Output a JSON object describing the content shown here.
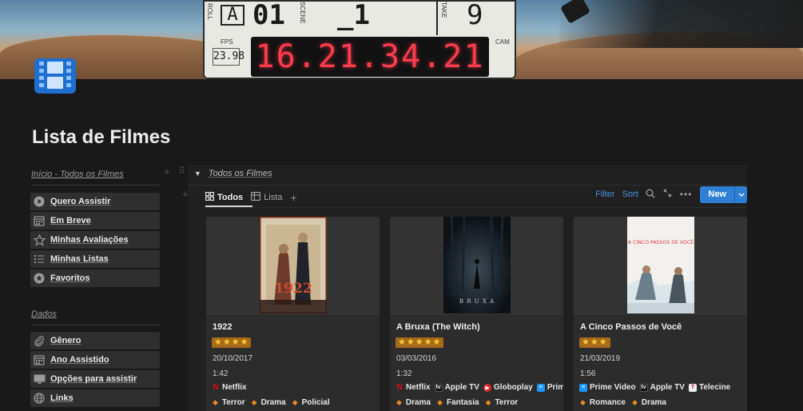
{
  "cover": {
    "slate": {
      "roll_label": "ROLL",
      "roll_value": "A",
      "scene_label": "SCENE",
      "scene_value": "01",
      "shot_value": "_1",
      "take_label": "TAKE",
      "take_value": "9",
      "fps_label": "FPS",
      "fps_value": "23.98",
      "cam_label": "CAM",
      "timecode": "16.21.34.21"
    }
  },
  "page": {
    "icon": "film-icon",
    "title": "Lista de Filmes"
  },
  "nav": {
    "section1_title": "Início - Todos os Filmes",
    "section1_items": [
      {
        "label": "Quero Assistir",
        "icon": "play-circle-icon"
      },
      {
        "label": "Em Breve",
        "icon": "calendar-icon"
      },
      {
        "label": "Minhas Avaliações",
        "icon": "star-outline-icon"
      },
      {
        "label": "Minhas Listas",
        "icon": "list-icon"
      },
      {
        "label": "Favoritos",
        "icon": "star-circle-icon"
      }
    ],
    "section2_title": "Dados",
    "section2_items": [
      {
        "label": "Gênero",
        "icon": "paperclip-icon"
      },
      {
        "label": "Ano Assistido",
        "icon": "calendar-icon"
      },
      {
        "label": "Opções para assistir",
        "icon": "monitor-icon"
      },
      {
        "label": "Links",
        "icon": "globe-icon"
      }
    ]
  },
  "database": {
    "title": "Todos os Filmes",
    "views": [
      {
        "label": "Todos",
        "icon": "gallery-icon",
        "active": true
      },
      {
        "label": "Lista",
        "icon": "table-icon",
        "active": false
      }
    ],
    "toolbar": {
      "filter_label": "Filter",
      "sort_label": "Sort",
      "new_label": "New"
    },
    "cards": [
      {
        "name": "1922",
        "stars": "★★★★",
        "rating": 4,
        "date": "20/10/2017",
        "duration": "1:42",
        "streams": [
          {
            "label": "Netflix",
            "icon": "netflix-icon"
          }
        ],
        "genres": [
          "Terror",
          "Drama",
          "Policial"
        ]
      },
      {
        "name": "A Bruxa (The Witch)",
        "stars": "★★★★★",
        "rating": 5,
        "date": "03/03/2016",
        "duration": "1:32",
        "streams": [
          {
            "label": "Netflix",
            "icon": "netflix-icon"
          },
          {
            "label": "Apple TV",
            "icon": "appletv-icon"
          },
          {
            "label": "Globoplay",
            "icon": "globoplay-icon"
          },
          {
            "label": "Prime V",
            "icon": "primevideo-icon"
          }
        ],
        "genres": [
          "Drama",
          "Fantasia",
          "Terror"
        ]
      },
      {
        "name": "A Cinco Passos de Você",
        "stars": "★★★",
        "rating": 3,
        "date": "21/03/2019",
        "duration": "1:56",
        "streams": [
          {
            "label": "Prime Video",
            "icon": "primevideo-icon"
          },
          {
            "label": "Apple TV",
            "icon": "appletv-icon"
          },
          {
            "label": "Telecine",
            "icon": "telecine-icon"
          }
        ],
        "genres": [
          "Romance",
          "Drama"
        ]
      }
    ]
  },
  "posters": {
    "p1_title": "1922",
    "p2_title": "B R U X A",
    "p3_title": "A CINCO PASSOS DE VOCÊ"
  },
  "colors": {
    "background": "#191919",
    "accent_blue": "#2f80d5",
    "link_blue": "#4a90d9",
    "star_bg": "#a76a19",
    "genre_dot": "#e58a1f"
  }
}
